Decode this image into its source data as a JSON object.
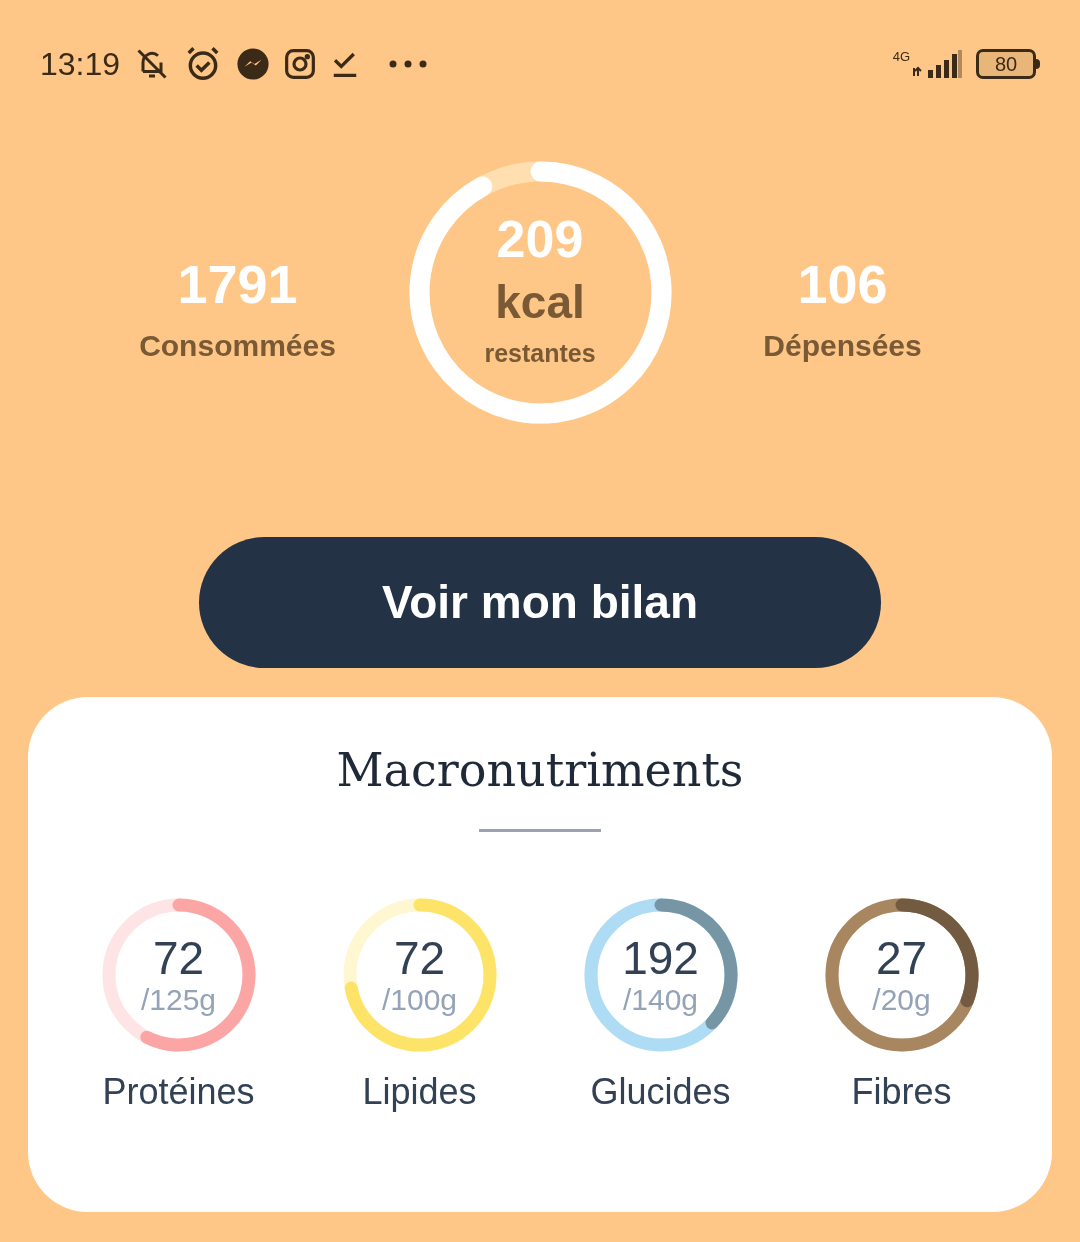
{
  "status_bar": {
    "time": "13:19",
    "network": "4G",
    "battery": "80"
  },
  "calories": {
    "remaining": "209",
    "unit": "kcal",
    "remaining_label": "restantes",
    "consumed": {
      "value": "1791",
      "label": "Consommées"
    },
    "burned": {
      "value": "106",
      "label": "Dépensées"
    }
  },
  "button": "Voir mon bilan",
  "macros": {
    "title": "Macronutriments",
    "items": [
      {
        "value": "72",
        "target": "/125g",
        "label": "Protéines",
        "color": "#fca5a5"
      },
      {
        "value": "72",
        "target": "/100g",
        "label": "Lipides",
        "color": "#fde468"
      },
      {
        "value": "192",
        "target": "/140g",
        "label": "Glucides",
        "color": "#aedcf4"
      },
      {
        "value": "27",
        "target": "/20g",
        "label": "Fibres",
        "color": "#a88660"
      }
    ]
  }
}
